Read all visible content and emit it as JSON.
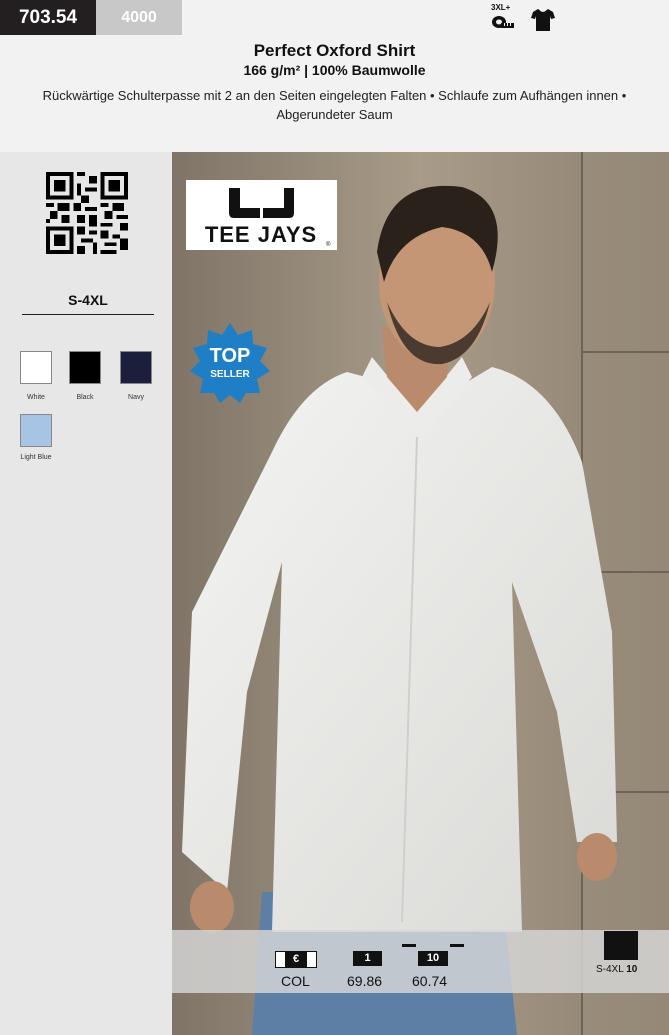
{
  "article": {
    "code": "703.54",
    "secondary_code": "4000"
  },
  "badges": {
    "size_badge": "3XL+"
  },
  "product": {
    "title": "Perfect Oxford Shirt",
    "subtitle": "166 g/m² | 100% Baumwolle",
    "description": "Rückwärtige Schulterpasse mit 2 an den Seiten eingelegten Falten • Schlaufe zum Aufhängen innen • Abgerundeter Saum"
  },
  "sizes": "S-4XL",
  "colors": [
    {
      "name": "White",
      "hex": "#ffffff"
    },
    {
      "name": "Black",
      "hex": "#000000"
    },
    {
      "name": "Navy",
      "hex": "#1b1f3b"
    },
    {
      "name": "Light Blue",
      "hex": "#a8c4e4"
    }
  ],
  "brand": {
    "name": "TEE JAYS",
    "registered": "®"
  },
  "top_seller": {
    "line1": "TOP",
    "line2": "SELLER",
    "color": "#1e7fc6"
  },
  "pricing": {
    "currency_symbol": "€",
    "col_label": "COL",
    "tier1_qty": "1",
    "tier1_price": "69.86",
    "tier2_qty": "10",
    "tier2_price": "60.74"
  },
  "packing": {
    "sizes": "S-4XL",
    "qty": "10"
  }
}
